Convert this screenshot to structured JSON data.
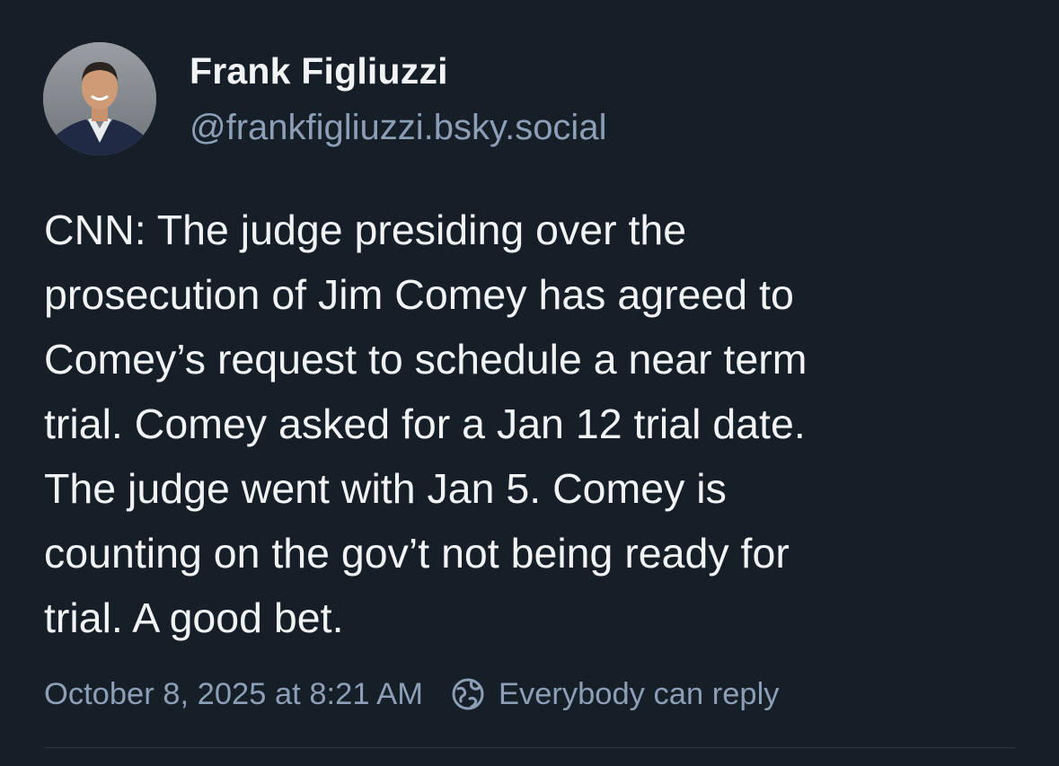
{
  "author": {
    "display_name": "Frank Figliuzzi",
    "handle": "@frankfigliuzzi.bsky.social",
    "avatar_icon": "profile-photo"
  },
  "post": {
    "text": "CNN: The judge presiding over the\nprosecution of Jim Comey has agreed to\nComey’s request to schedule a near term\ntrial. Comey asked for a Jan 12 trial date.\nThe judge went with Jan 5. Comey is\ncounting on the gov’t not being ready for\ntrial. A good bet."
  },
  "meta": {
    "timestamp": "October 8, 2025 at 8:21 AM",
    "reply_setting": "Everybody can reply",
    "reply_icon": "globe-icon"
  },
  "colors": {
    "background": "#161e27",
    "primary_text": "#f1f3f5",
    "secondary_text": "#8c9fb6",
    "divider": "#2b3642"
  }
}
